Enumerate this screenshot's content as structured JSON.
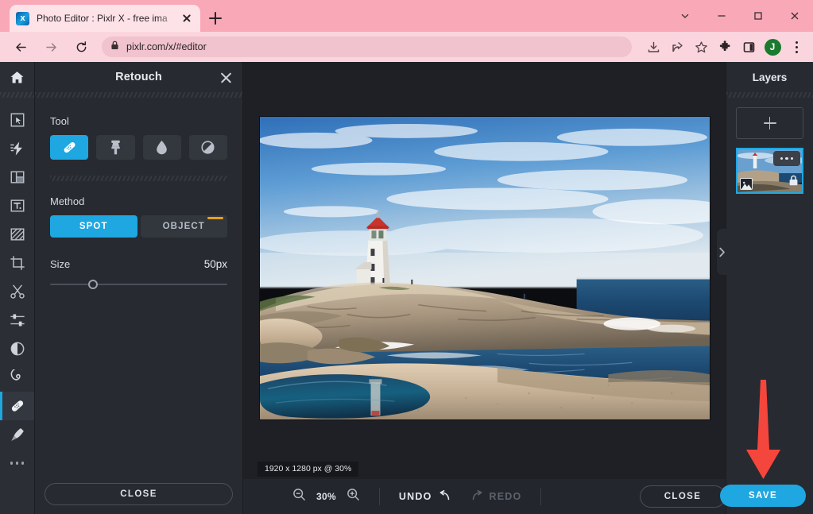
{
  "browser": {
    "tab": {
      "title": "Photo Editor : Pixlr X - free ima",
      "favicon": "pixlr-favicon",
      "close_icon": "close-icon"
    },
    "new_tab_label": "+",
    "window_controls": {
      "collapse": "chevron-down-icon",
      "minimize": "minimize-icon",
      "maximize": "maximize-icon",
      "close": "close-icon"
    },
    "nav": {
      "back": "back-arrow-icon",
      "forward": "forward-arrow-icon",
      "reload": "reload-icon"
    },
    "omnibox": {
      "url": "pixlr.com/x/#editor",
      "lock_icon": "lock-icon"
    },
    "toolbar_icons": [
      "download-icon",
      "share-icon",
      "bookmark-star-icon",
      "extensions-puzzle-icon",
      "side-panel-icon"
    ],
    "profile": {
      "initial": "J",
      "color": "#1a7a2e"
    },
    "menu_icon": "three-dots-vertical-icon",
    "theme_color": "#f9a8b8"
  },
  "tool_rail": {
    "home_icon": "home-icon",
    "items": [
      {
        "name": "arrange",
        "icon": "arrange-cursor-icon",
        "active": false
      },
      {
        "name": "ai-tools",
        "icon": "lightning-bolt-icon",
        "active": false
      },
      {
        "name": "layout",
        "icon": "layout-frame-icon",
        "active": false
      },
      {
        "name": "text",
        "icon": "text-t-icon",
        "active": false
      },
      {
        "name": "draw",
        "icon": "pattern-fill-icon",
        "active": false
      },
      {
        "name": "crop",
        "icon": "crop-icon",
        "active": false
      },
      {
        "name": "cutout",
        "icon": "scissors-icon",
        "active": false
      },
      {
        "name": "adjust",
        "icon": "sliders-icon",
        "active": false
      },
      {
        "name": "effects",
        "icon": "contrast-circle-icon",
        "active": false
      },
      {
        "name": "liquify",
        "icon": "spiral-icon",
        "active": false
      },
      {
        "name": "retouch",
        "icon": "bandage-icon",
        "active": true
      },
      {
        "name": "paint",
        "icon": "brush-icon",
        "active": false
      },
      {
        "name": "more",
        "icon": "three-dots-icon",
        "active": false
      }
    ]
  },
  "panel": {
    "title": "Retouch",
    "close_icon": "close-icon",
    "tool": {
      "label": "Tool",
      "options": [
        {
          "name": "heal",
          "icon": "bandage-icon",
          "active": true
        },
        {
          "name": "clone",
          "icon": "clone-stamp-icon",
          "active": false
        },
        {
          "name": "blur",
          "icon": "water-drop-icon",
          "active": false
        },
        {
          "name": "dodge-burn",
          "icon": "contrast-circle-icon",
          "active": false
        }
      ]
    },
    "method": {
      "label": "Method",
      "spot_label": "SPOT",
      "object_label": "OBJECT",
      "selected": "SPOT",
      "object_is_premium": true,
      "premium_color": "#e5a21b"
    },
    "size": {
      "label": "Size",
      "value": "50px",
      "percent": 24
    },
    "close_button": "CLOSE"
  },
  "canvas": {
    "dimensions_badge": "1920 x 1280 px @ 30%",
    "image_alt": "lighthouse-on-rocky-coast-photo"
  },
  "bottom_bar": {
    "zoom_out_icon": "zoom-out-icon",
    "zoom_in_icon": "zoom-in-icon",
    "zoom_level": "30%",
    "undo_label": "UNDO",
    "undo_icon": "undo-arrow-icon",
    "redo_label": "REDO",
    "redo_icon": "redo-arrow-icon",
    "redo_disabled": true,
    "close_label": "CLOSE",
    "save_label": "SAVE",
    "save_color": "#1ea7e1"
  },
  "layers": {
    "title": "Layers",
    "add_icon": "plus-icon",
    "items": [
      {
        "name": "background-layer",
        "selected": true,
        "menu_icon": "three-dots-icon",
        "type_icon": "image-icon",
        "lock_icon": "lock-icon"
      }
    ],
    "collapse_icon": "chevron-right-icon"
  },
  "annotation": {
    "arrow": "red-down-arrow",
    "color": "#f4463c",
    "points_to": "save-button"
  }
}
